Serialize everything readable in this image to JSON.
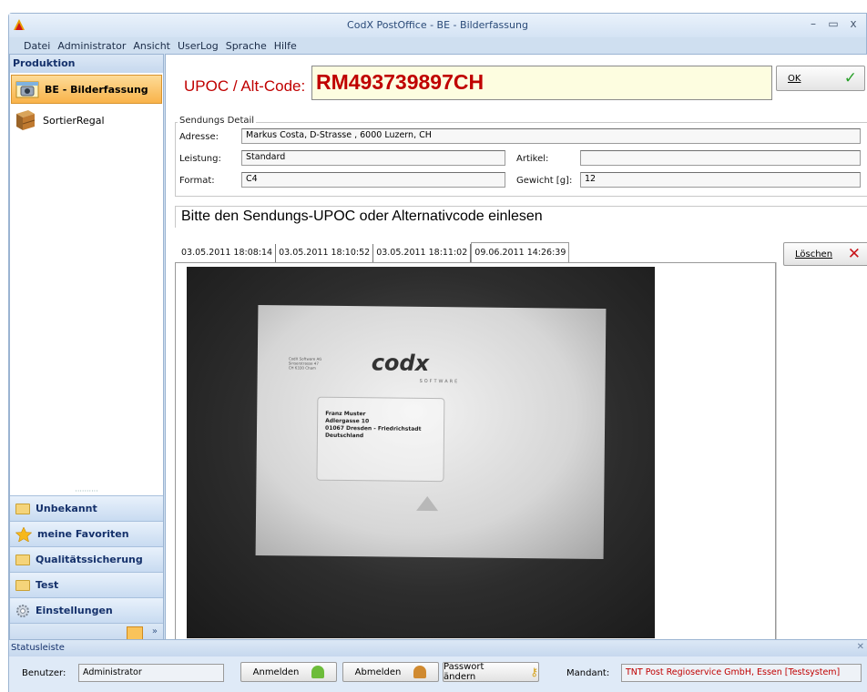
{
  "window": {
    "title": "CodX PostOffice - BE - Bilderfassung"
  },
  "menu": [
    "Datei",
    "Administrator",
    "Ansicht",
    "UserLog",
    "Sprache",
    "Hilfe"
  ],
  "sidebar": {
    "header": "Produktion",
    "items": [
      {
        "label": "BE - Bilderfassung",
        "icon": "camera-icon",
        "active": true
      },
      {
        "label": "SortierRegal",
        "icon": "shelf-icon",
        "active": false
      }
    ],
    "groups": [
      {
        "label": "Unbekannt",
        "icon": "folder-icon"
      },
      {
        "label": "meine Favoriten",
        "icon": "star-icon"
      },
      {
        "label": "Qualitätssicherung",
        "icon": "folder-icon"
      },
      {
        "label": "Test",
        "icon": "folder-icon"
      },
      {
        "label": "Einstellungen",
        "icon": "gear-icon"
      }
    ]
  },
  "upoc": {
    "label": "UPOC / Alt-Code:",
    "value": "RM493739897CH",
    "ok_label": "OK"
  },
  "detail": {
    "legend": "Sendungs Detail",
    "adresse_label": "Adresse:",
    "adresse_value": "Markus Costa, D-Strasse , 6000 Luzern, CH",
    "leistung_label": "Leistung:",
    "leistung_value": "Standard",
    "artikel_label": "Artikel:",
    "artikel_value": "",
    "format_label": "Format:",
    "format_value": "C4",
    "gewicht_label": "Gewicht [g]:",
    "gewicht_value": "12"
  },
  "prompt": "Bitte den Sendungs-UPOC oder Alternativcode einlesen",
  "tabs": [
    "03.05.2011 18:08:14",
    "03.05.2011 18:10:52",
    "03.05.2011 18:11:02",
    "09.06.2011 14:26:39"
  ],
  "active_tab": 3,
  "delete_label": "Löschen",
  "scan": {
    "sender": [
      "CodX Software AG",
      "Sinserstrasse 47",
      "CH 6330 Cham"
    ],
    "logo": "codx",
    "logo_sub": "SOFTWARE",
    "recipient": [
      "Franz Muster",
      "Adlergasse 10",
      "01067 Dresden - Friedrichstadt",
      "Deutschland"
    ]
  },
  "status": {
    "title": "Statusleiste",
    "benutzer_label": "Benutzer:",
    "benutzer_value": "Administrator",
    "anmelden": "Anmelden",
    "abmelden": "Abmelden",
    "passwort": "Passwort ändern",
    "mandant_label": "Mandant:",
    "mandant_value": "TNT Post Regioservice GmbH, Essen [Testsystem]"
  },
  "colors": {
    "accent_red": "#c00000",
    "active_nav": "#f9b34a",
    "window_bg": "#cfdff0"
  }
}
